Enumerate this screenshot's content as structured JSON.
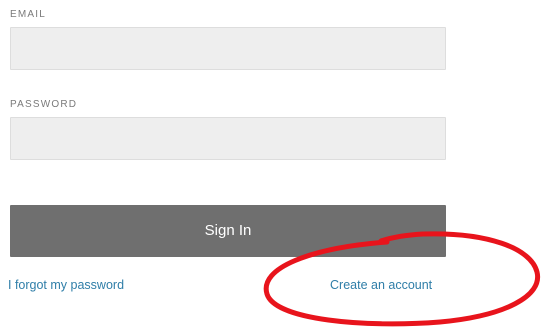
{
  "form": {
    "email": {
      "label": "EMAIL",
      "value": "",
      "placeholder": ""
    },
    "password": {
      "label": "PASSWORD",
      "value": "",
      "placeholder": ""
    },
    "sign_in_label": "Sign In"
  },
  "links": {
    "forgot_password": "I forgot my password",
    "create_account": "Create an account"
  },
  "colors": {
    "input_background": "#eeeeee",
    "button_background": "#6f6f6f",
    "link": "#2f7ea8",
    "annotation_circle": "#e8141c"
  }
}
